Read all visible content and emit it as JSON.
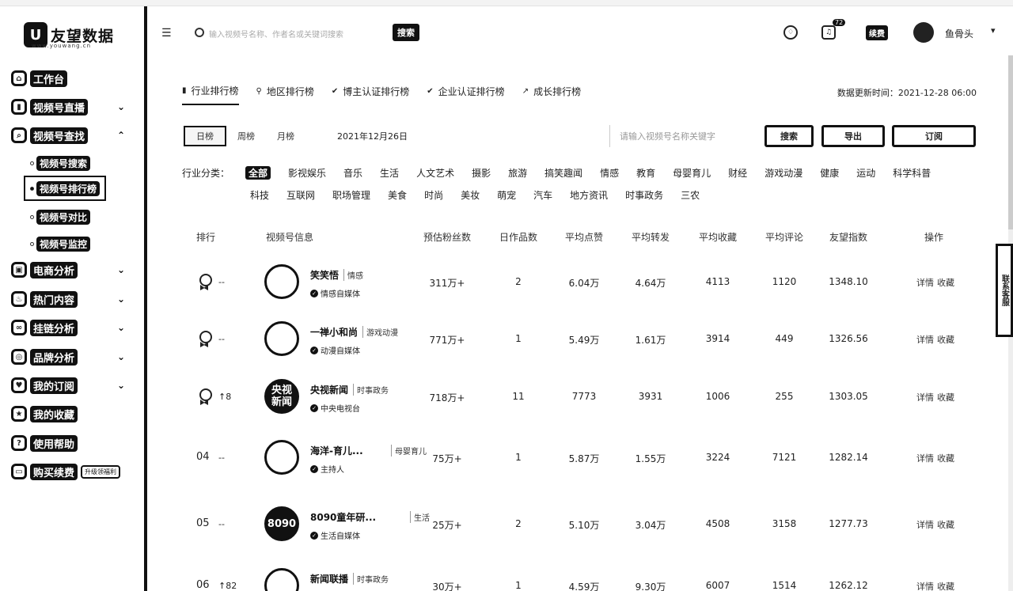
{
  "app": {
    "logo_mark": "U",
    "logo_text": "友望数据",
    "logo_sub": "www.youwang.cn"
  },
  "sidebar": {
    "items": [
      {
        "label": "工作台",
        "icon": "home-icon"
      },
      {
        "label": "视频号直播",
        "icon": "chart-icon"
      },
      {
        "label": "视频号查找",
        "icon": "search-icon"
      },
      {
        "label": "电商分析",
        "icon": "bag-icon"
      },
      {
        "label": "热门内容",
        "icon": "fire-icon"
      },
      {
        "label": "挂链分析",
        "icon": "link-icon"
      },
      {
        "label": "品牌分析",
        "icon": "brand-icon"
      },
      {
        "label": "我的订阅",
        "icon": "heart-icon"
      },
      {
        "label": "我的收藏",
        "icon": "star-icon"
      },
      {
        "label": "使用帮助",
        "icon": "help-icon"
      },
      {
        "label": "购买续费",
        "icon": "card-icon",
        "badge": "升级领福利"
      }
    ],
    "sub_items": [
      {
        "label": "视频号搜索"
      },
      {
        "label": "视频号排行榜"
      },
      {
        "label": "视频号对比"
      },
      {
        "label": "视频号监控"
      }
    ]
  },
  "header": {
    "search_placeholder": "输入视频号名称、作者名或关键词搜索",
    "search_button": "搜索",
    "notification_count": "72",
    "topup_label": "续费",
    "username": "鱼骨头"
  },
  "tabs": [
    {
      "label": "行业排行榜",
      "icon": "bar-icon"
    },
    {
      "label": "地区排行榜",
      "icon": "pin-icon"
    },
    {
      "label": "博主认证排行榜",
      "icon": "badge-icon"
    },
    {
      "label": "企业认证排行榜",
      "icon": "badge-icon"
    },
    {
      "label": "成长排行榜",
      "icon": "growth-icon"
    }
  ],
  "update_time": "数据更新时间：2021-12-28 06:00",
  "periods": [
    "日榜",
    "周榜",
    "月榜"
  ],
  "selected_date": "2021年12月26日",
  "rank_search_placeholder": "请输入视频号名称关键字",
  "buttons": {
    "search": "搜索",
    "export": "导出",
    "subscribe": "订阅"
  },
  "category_label": "行业分类：",
  "categories_row1": [
    "全部",
    "影视娱乐",
    "音乐",
    "生活",
    "人文艺术",
    "摄影",
    "旅游",
    "搞笑趣闻",
    "情感",
    "教育",
    "母婴育儿",
    "财经",
    "游戏动漫",
    "健康",
    "运动",
    "科学科普"
  ],
  "categories_row2": [
    "科技",
    "互联网",
    "职场管理",
    "美食",
    "时尚",
    "美妆",
    "萌宠",
    "汽车",
    "地方资讯",
    "时事政务",
    "三农"
  ],
  "table": {
    "headers": [
      "排行",
      "视频号信息",
      "预估粉丝数",
      "日作品数",
      "平均点赞",
      "平均转发",
      "平均收藏",
      "平均评论",
      "友望指数",
      "操作"
    ],
    "rows": [
      {
        "rank": "",
        "trend": "--",
        "name": "笑笑悟",
        "tag": "情感",
        "verify": "情感自媒体",
        "fans": "311万+",
        "works": "2",
        "likes": "6.04万",
        "shares": "4.64万",
        "favs": "4113",
        "comments": "1120",
        "index": "1348.10",
        "avatar_text": ""
      },
      {
        "rank": "",
        "trend": "--",
        "name": "一禅小和尚",
        "tag": "游戏动漫",
        "verify": "动漫自媒体",
        "fans": "771万+",
        "works": "1",
        "likes": "5.49万",
        "shares": "1.61万",
        "favs": "3914",
        "comments": "449",
        "index": "1326.56",
        "avatar_text": ""
      },
      {
        "rank": "",
        "trend": "↑8",
        "name": "央视新闻",
        "tag": "时事政务",
        "verify": "中央电视台",
        "fans": "718万+",
        "works": "11",
        "likes": "7773",
        "shares": "3931",
        "favs": "1006",
        "comments": "255",
        "index": "1303.05",
        "avatar_text": "央视新闻"
      },
      {
        "rank": "04",
        "trend": "--",
        "name": "海洋-育儿...",
        "tag": "母婴育儿",
        "verify": "主持人",
        "fans": "75万+",
        "works": "1",
        "likes": "5.87万",
        "shares": "1.55万",
        "favs": "3224",
        "comments": "7121",
        "index": "1282.14",
        "avatar_text": ""
      },
      {
        "rank": "05",
        "trend": "--",
        "name": "8090童年研...",
        "tag": "生活",
        "verify": "生活自媒体",
        "fans": "25万+",
        "works": "2",
        "likes": "5.10万",
        "shares": "3.04万",
        "favs": "4508",
        "comments": "3158",
        "index": "1277.73",
        "avatar_text": "8090"
      },
      {
        "rank": "06",
        "trend": "↑82",
        "name": "新闻联播",
        "tag": "时事政务",
        "verify": "",
        "fans": "30万+",
        "works": "1",
        "likes": "4.59万",
        "shares": "9.30万",
        "favs": "6007",
        "comments": "1514",
        "index": "1262.12",
        "avatar_text": ""
      }
    ],
    "op_detail": "详情",
    "op_collect": "收藏"
  },
  "side_tab": "联系客服"
}
